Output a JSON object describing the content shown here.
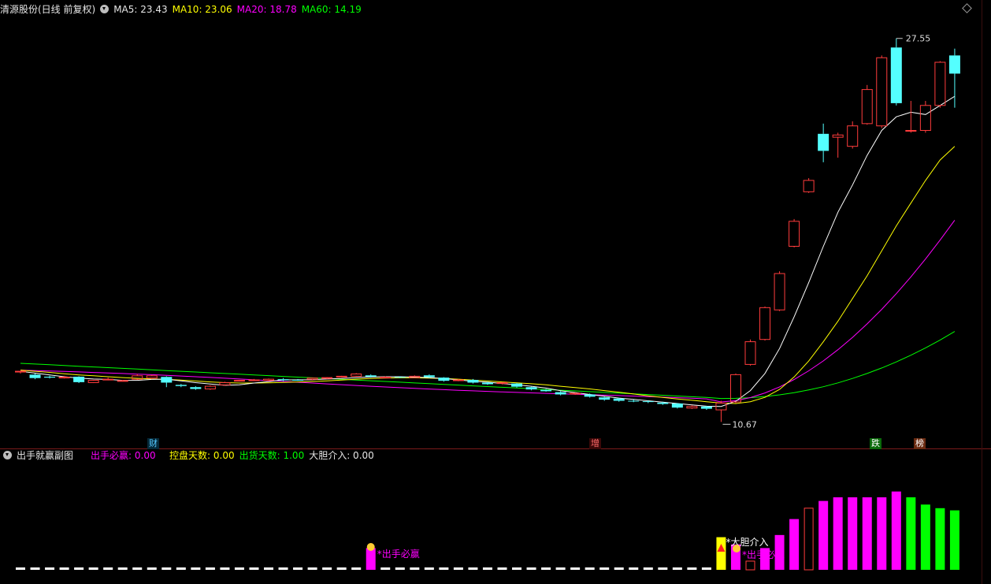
{
  "main_header": {
    "title": "清源股份(日线 前复权)",
    "ma5": "MA5: 23.43",
    "ma10": "MA10: 23.06",
    "ma20": "MA20: 18.78",
    "ma60": "MA60: 14.19"
  },
  "sub_header": {
    "title": "出手就赢副图",
    "f1": "出手必赢: 0.00",
    "f2": "控盘天数: 0.00",
    "f3": "出货天数: 1.00",
    "f4": "大胆介入: 0.00"
  },
  "markers": {
    "cai": "财",
    "zeng": "增",
    "die": "跌",
    "bang": "榜"
  },
  "colors": {
    "up": "#ff3c3c",
    "down": "#54ffff",
    "ma5": "#ffffff",
    "ma10": "#ffff00",
    "ma20": "#ff00ff",
    "ma60": "#00ff00"
  },
  "chart_data": [
    {
      "type": "candlestick",
      "title": "清源股份(日线 前复权)",
      "ylim": [
        10,
        28
      ],
      "annotations": {
        "high": "27.55",
        "low": "10.67"
      },
      "candles": [
        [
          12.9,
          12.9,
          12.9,
          12.8
        ],
        [
          12.75,
          12.6,
          12.8,
          12.55
        ],
        [
          12.66,
          12.62,
          12.7,
          12.58
        ],
        [
          12.62,
          12.64,
          12.7,
          12.58
        ],
        [
          12.66,
          12.42,
          12.68,
          12.38
        ],
        [
          12.4,
          12.5,
          12.52,
          12.38
        ],
        [
          12.55,
          12.55,
          12.62,
          12.5
        ],
        [
          12.48,
          12.49,
          12.52,
          12.46
        ],
        [
          12.55,
          12.7,
          12.78,
          12.52
        ],
        [
          12.6,
          12.7,
          12.74,
          12.55
        ],
        [
          12.65,
          12.4,
          12.68,
          12.2
        ],
        [
          12.3,
          12.25,
          12.34,
          12.2
        ],
        [
          12.2,
          12.12,
          12.24,
          12.08
        ],
        [
          12.12,
          12.24,
          12.28,
          12.08
        ],
        [
          12.3,
          12.4,
          12.44,
          12.26
        ],
        [
          12.48,
          12.5,
          12.52,
          12.45
        ],
        [
          12.52,
          12.52,
          12.56,
          12.48
        ],
        [
          12.5,
          12.55,
          12.58,
          12.46
        ],
        [
          12.55,
          12.5,
          12.6,
          12.46
        ],
        [
          12.52,
          12.5,
          12.56,
          12.48
        ],
        [
          12.55,
          12.6,
          12.62,
          12.5
        ],
        [
          12.6,
          12.62,
          12.64,
          12.56
        ],
        [
          12.66,
          12.68,
          12.7,
          12.62
        ],
        [
          12.68,
          12.78,
          12.82,
          12.66
        ],
        [
          12.72,
          12.66,
          12.76,
          12.62
        ],
        [
          12.63,
          12.64,
          12.68,
          12.6
        ],
        [
          12.65,
          12.62,
          12.68,
          12.6
        ],
        [
          12.62,
          12.68,
          12.72,
          12.6
        ],
        [
          12.72,
          12.64,
          12.76,
          12.6
        ],
        [
          12.62,
          12.48,
          12.64,
          12.44
        ],
        [
          12.5,
          12.52,
          12.56,
          12.46
        ],
        [
          12.52,
          12.4,
          12.56,
          12.36
        ],
        [
          12.4,
          12.33,
          12.44,
          12.3
        ],
        [
          12.36,
          12.4,
          12.42,
          12.32
        ],
        [
          12.36,
          12.22,
          12.38,
          12.18
        ],
        [
          12.2,
          12.1,
          12.22,
          12.06
        ],
        [
          12.08,
          12.02,
          12.12,
          12.0
        ],
        [
          11.98,
          11.88,
          12.02,
          11.84
        ],
        [
          11.9,
          11.93,
          11.96,
          11.86
        ],
        [
          11.88,
          11.78,
          11.92,
          11.74
        ],
        [
          11.75,
          11.65,
          11.78,
          11.6
        ],
        [
          11.7,
          11.6,
          11.74,
          11.56
        ],
        [
          11.6,
          11.58,
          11.66,
          11.54
        ],
        [
          11.58,
          11.55,
          11.62,
          11.5
        ],
        [
          11.52,
          11.46,
          11.56,
          11.42
        ],
        [
          11.48,
          11.3,
          11.5,
          11.26
        ],
        [
          11.28,
          11.35,
          11.4,
          11.24
        ],
        [
          11.35,
          11.25,
          11.38,
          11.2
        ],
        [
          11.2,
          11.5,
          11.6,
          10.67
        ],
        [
          11.55,
          12.75,
          12.8,
          11.5
        ],
        [
          13.2,
          14.2,
          14.3,
          13.15
        ],
        [
          14.3,
          15.7,
          15.75,
          14.25
        ],
        [
          15.6,
          17.2,
          17.3,
          15.55
        ],
        [
          18.4,
          19.5,
          19.6,
          18.35
        ],
        [
          20.8,
          21.3,
          21.4,
          20.75
        ],
        [
          23.35,
          22.6,
          23.8,
          22.1
        ],
        [
          23.2,
          23.3,
          23.4,
          22.3
        ],
        [
          22.8,
          23.7,
          23.9,
          22.7
        ],
        [
          23.8,
          25.3,
          25.5,
          23.75
        ],
        [
          23.7,
          26.7,
          26.8,
          23.6
        ],
        [
          27.15,
          24.7,
          27.55,
          24.6
        ],
        [
          23.5,
          23.5,
          24.8,
          23.4
        ],
        [
          23.5,
          24.6,
          24.8,
          23.4
        ],
        [
          24.6,
          26.5,
          26.55,
          24.5
        ],
        [
          26.8,
          26.0,
          27.1,
          24.5
        ]
      ],
      "ma5": [
        12.9,
        12.82,
        12.74,
        12.66,
        12.6,
        12.56,
        12.54,
        12.5,
        12.5,
        12.54,
        12.55,
        12.48,
        12.4,
        12.34,
        12.28,
        12.3,
        12.38,
        12.44,
        12.52,
        12.52,
        12.53,
        12.56,
        12.58,
        12.62,
        12.65,
        12.66,
        12.66,
        12.64,
        12.62,
        12.58,
        12.52,
        12.46,
        12.42,
        12.36,
        12.3,
        12.24,
        12.16,
        12.04,
        11.96,
        11.88,
        11.8,
        11.72,
        11.66,
        11.6,
        11.54,
        11.48,
        11.42,
        11.36,
        11.35,
        11.58,
        12.05,
        12.8,
        13.9,
        15.3,
        16.8,
        18.4,
        19.9,
        21.1,
        22.4,
        23.5,
        24.1,
        24.3,
        24.2,
        24.6,
        25.0
      ],
      "ma10": [
        12.95,
        12.9,
        12.85,
        12.79,
        12.74,
        12.7,
        12.66,
        12.62,
        12.59,
        12.56,
        12.54,
        12.51,
        12.47,
        12.43,
        12.4,
        12.38,
        12.38,
        12.39,
        12.41,
        12.43,
        12.45,
        12.48,
        12.51,
        12.55,
        12.58,
        12.6,
        12.61,
        12.61,
        12.6,
        12.58,
        12.55,
        12.51,
        12.47,
        12.43,
        12.39,
        12.35,
        12.3,
        12.24,
        12.18,
        12.12,
        12.05,
        11.98,
        11.9,
        11.82,
        11.75,
        11.68,
        11.62,
        11.56,
        11.5,
        11.48,
        11.56,
        11.75,
        12.1,
        12.65,
        13.35,
        14.2,
        15.1,
        16.1,
        17.1,
        18.2,
        19.3,
        20.3,
        21.3,
        22.2,
        22.8
      ]
    },
    {
      "type": "bar",
      "title": "出手就赢副图",
      "series_names": [
        "出手必赢",
        "控盘天数",
        "出货天数",
        "大胆介入"
      ],
      "labels": [
        "出手必赢",
        "大胆介入",
        "出手必赢"
      ],
      "values": [
        0.02,
        0.02,
        0.02,
        0.02,
        0.02,
        0.02,
        0.02,
        0.02,
        0.02,
        0.02,
        0.02,
        0.02,
        0.02,
        0.02,
        0.02,
        0.02,
        0.02,
        0.02,
        0.02,
        0.02,
        0.01,
        0.01,
        0.01,
        0.01,
        0.3,
        0.01,
        0.01,
        0.01,
        0.01,
        0.01,
        0.01,
        0.01,
        0.02,
        0.02,
        0.02,
        0.02,
        0.02,
        0.02,
        0.02,
        0.02,
        0.02,
        0.02,
        0.02,
        0.02,
        0.02,
        0.02,
        0.02,
        0.02,
        0.45,
        0.35,
        0.12,
        0.3,
        0.48,
        0.7,
        0.85,
        0.95,
        1.0,
        1.0,
        1.0,
        1.0,
        1.08,
        1.0,
        0.9,
        0.85,
        0.82
      ]
    }
  ]
}
